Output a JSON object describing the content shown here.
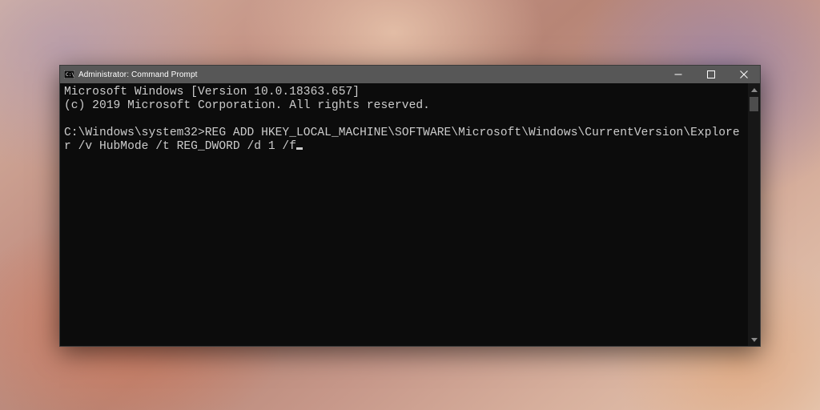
{
  "window": {
    "title": "Administrator: Command Prompt"
  },
  "terminal": {
    "line1": "Microsoft Windows [Version 10.0.18363.657]",
    "line2": "(c) 2019 Microsoft Corporation. All rights reserved.",
    "blank": "",
    "prompt": "C:\\Windows\\system32>",
    "command": "REG ADD HKEY_LOCAL_MACHINE\\SOFTWARE\\Microsoft\\Windows\\CurrentVersion\\Explorer /v HubMode /t REG_DWORD /d 1 /f"
  },
  "icons": {
    "title": "cmd-icon",
    "minimize": "minimize-icon",
    "maximize": "maximize-icon",
    "close": "close-icon",
    "scroll_up": "scroll-up-icon",
    "scroll_down": "scroll-down-icon"
  }
}
